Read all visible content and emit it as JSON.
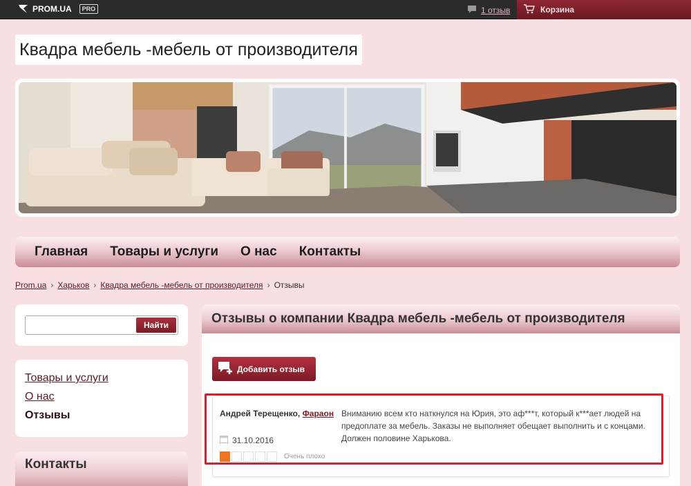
{
  "topbar": {
    "logo_text": "PROM.UA",
    "pro_badge": "PRO",
    "reviews_link": "1 отзыв",
    "cart_label": "Корзина"
  },
  "site": {
    "title": "Квадра мебель -мебель от производителя"
  },
  "nav": {
    "items": [
      "Главная",
      "Товары и услуги",
      "О нас",
      "Контакты"
    ]
  },
  "breadcrumb": {
    "items": [
      "Prom.ua",
      "Харьков",
      "Квадра мебель -мебель от производителя"
    ],
    "current": "Отзывы",
    "separator": "›"
  },
  "search": {
    "placeholder": "",
    "button_label": "Найти"
  },
  "sidebar": {
    "items": [
      "Товары и услуги",
      "О нас"
    ],
    "active": "Отзывы",
    "contacts_title": "Контакты"
  },
  "main": {
    "title": "Отзывы о компании Квадра мебель -мебель от производителя",
    "add_review_label": "Добавить отзыв"
  },
  "review": {
    "author": "Андрей Терещенко,",
    "author_link": "Фараон",
    "date": "31.10.2016",
    "rating": 1,
    "rating_max": 5,
    "rating_label": "Очень плохо",
    "text": "Вниманию всем кто наткнулся на Юрия, это аф***т, который к***ает людей на предоплате за мебель. Заказы не выполняет обещает выполнить и с концами. Должен половине Харькова."
  },
  "colors": {
    "background": "#f7dfe2",
    "accent": "#7b1a25",
    "highlight": "#d4202f",
    "star": "#f07422"
  }
}
